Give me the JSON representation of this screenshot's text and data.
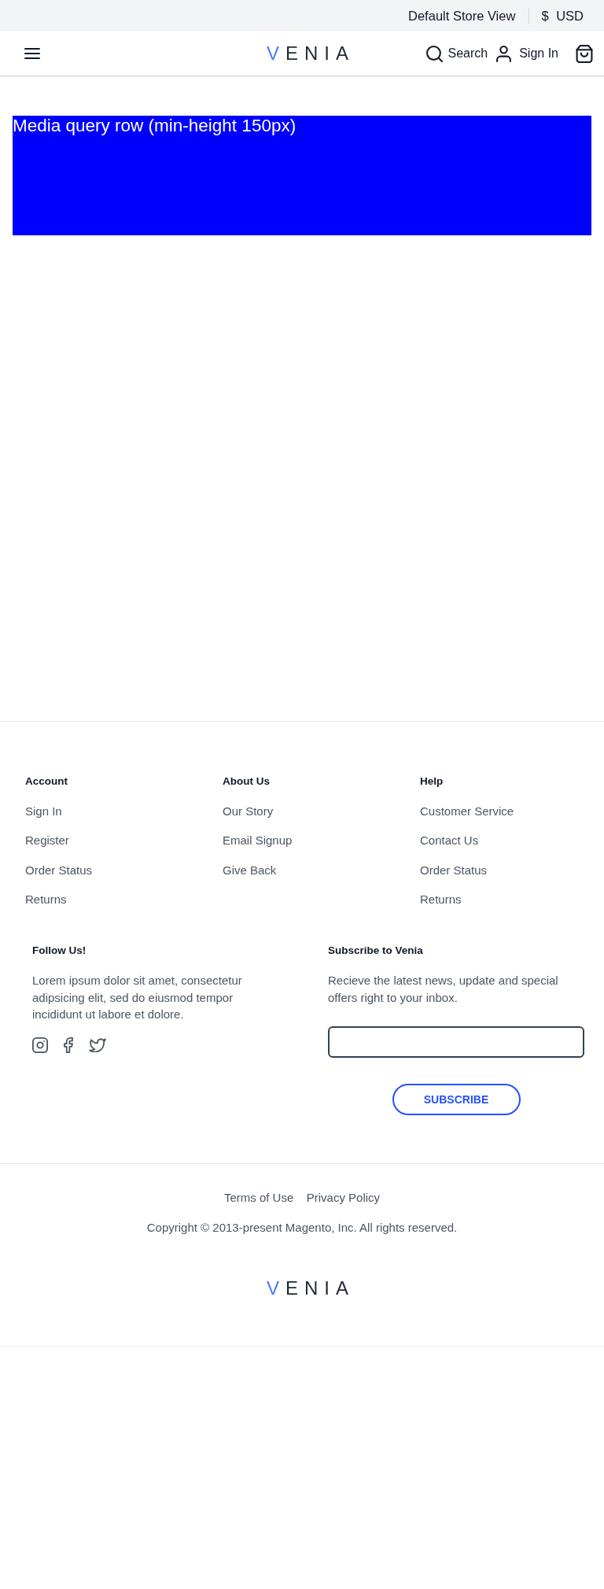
{
  "top_bar": {
    "store_view": "Default Store View",
    "currency_symbol": "$",
    "currency_code": "USD"
  },
  "header": {
    "logo": "VENIA",
    "search_label": "Search",
    "sign_in_label": "Sign In"
  },
  "content": {
    "row_text": "Media query row (min-height 150px)"
  },
  "footer": {
    "columns": [
      {
        "heading": "Account",
        "links": [
          "Sign In",
          "Register",
          "Order Status",
          "Returns"
        ]
      },
      {
        "heading": "About Us",
        "links": [
          "Our Story",
          "Email Signup",
          "Give Back"
        ]
      },
      {
        "heading": "Help",
        "links": [
          "Customer Service",
          "Contact Us",
          "Order Status",
          "Returns"
        ]
      }
    ],
    "follow": {
      "heading": "Follow Us!",
      "text": "Lorem ipsum dolor sit amet, consectetur adipsicing elit, sed do eiusmod tempor incididunt ut labore et dolore."
    },
    "subscribe": {
      "heading": "Subscribe to Venia",
      "text": "Recieve the latest news, update and special offers right to your inbox.",
      "button": "SUBSCRIBE"
    },
    "legal_links": [
      "Terms of Use",
      "Privacy Policy"
    ],
    "copyright": "Copyright © 2013-present Magento, Inc. All rights reserved.",
    "logo": "VENIA"
  }
}
